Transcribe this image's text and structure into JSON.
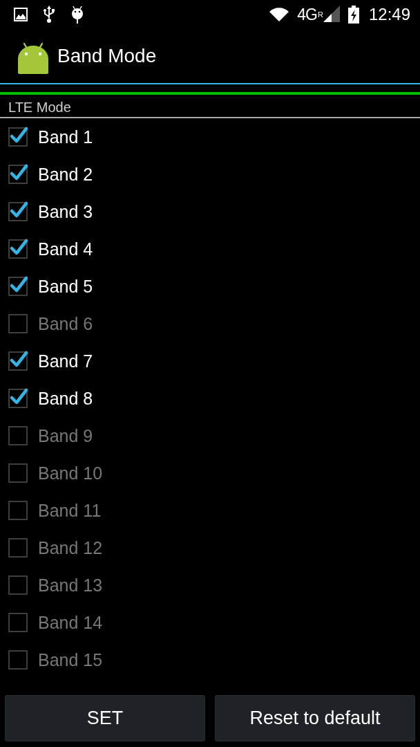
{
  "status_bar": {
    "network": "4G",
    "roaming": "R",
    "time": "12:49"
  },
  "action_bar": {
    "title": "Band Mode"
  },
  "section": {
    "title": "LTE Mode"
  },
  "bands": [
    {
      "label": "Band 1",
      "checked": true
    },
    {
      "label": "Band 2",
      "checked": true
    },
    {
      "label": "Band 3",
      "checked": true
    },
    {
      "label": "Band 4",
      "checked": true
    },
    {
      "label": "Band 5",
      "checked": true
    },
    {
      "label": "Band 6",
      "checked": false
    },
    {
      "label": "Band 7",
      "checked": true
    },
    {
      "label": "Band 8",
      "checked": true
    },
    {
      "label": "Band 9",
      "checked": false
    },
    {
      "label": "Band 10",
      "checked": false
    },
    {
      "label": "Band 11",
      "checked": false
    },
    {
      "label": "Band 12",
      "checked": false
    },
    {
      "label": "Band 13",
      "checked": false
    },
    {
      "label": "Band 14",
      "checked": false
    },
    {
      "label": "Band 15",
      "checked": false
    }
  ],
  "buttons": [
    {
      "label": "SET"
    },
    {
      "label": "Reset to default"
    }
  ]
}
